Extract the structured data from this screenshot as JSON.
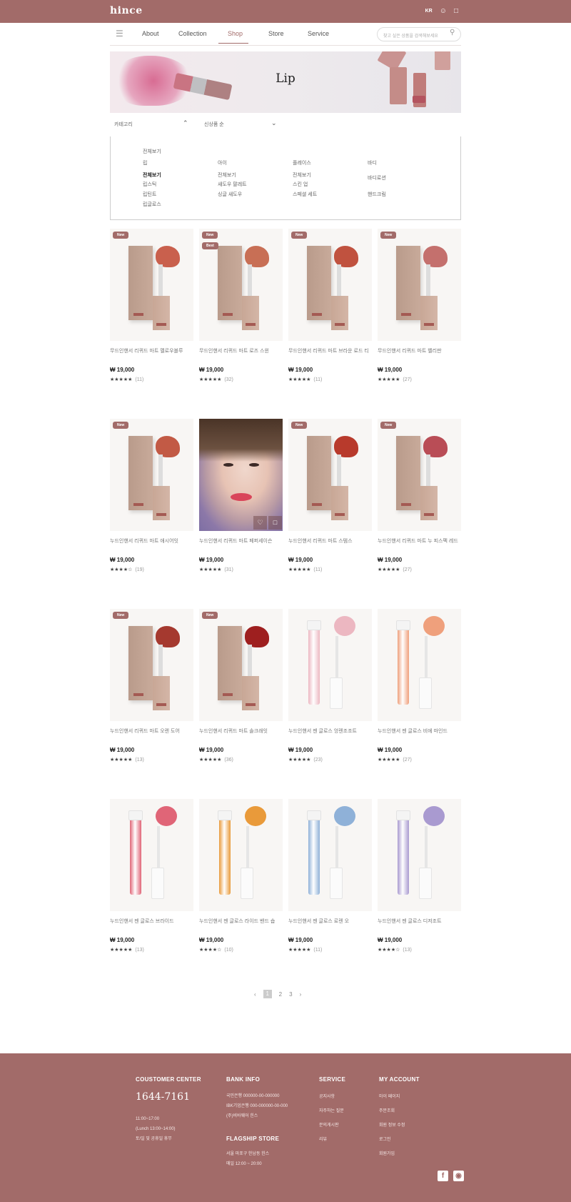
{
  "header": {
    "brand": "hince",
    "lang": "KR",
    "icons": [
      "user-icon",
      "bag-icon"
    ]
  },
  "nav": {
    "items": [
      "About",
      "Collection",
      "Shop",
      "Store",
      "Service"
    ],
    "active": "Shop",
    "search_placeholder": "찾고 싶은 상품을 검색해보세요"
  },
  "banner": {
    "title": "Lip"
  },
  "filters": {
    "category": "카테고리",
    "sort": "신상품 순"
  },
  "categories": {
    "all": "전체보기",
    "col1": [
      "립",
      "전체보기",
      "립스틱",
      "립틴트",
      "립글로스"
    ],
    "col2": [
      "아이",
      "전체보기",
      "섀도우 팔레트",
      "싱글 섀도우"
    ],
    "col3": [
      "플레이스",
      "전체보기",
      "스킨 업",
      "스페셜 세트"
    ],
    "col4": [
      "바디",
      "바디로션",
      "핸드크림"
    ]
  },
  "products": [
    {
      "name": "무드인핸서 리퀴드 마트 멜로우블루",
      "price": "₩ 19,000",
      "stars": "★★★★★",
      "count": "(11)",
      "badges": [
        "New"
      ]
    },
    {
      "name": "무드인핸서 리퀴드 마트 로즈 스윈",
      "price": "₩ 19,000",
      "stars": "★★★★★",
      "count": "(32)",
      "badges": [
        "New",
        "Best"
      ]
    },
    {
      "name": "무드인핸서 리퀴드 마트 브라운 로드 티",
      "price": "₩ 19,000",
      "stars": "★★★★★",
      "count": "(11)",
      "badges": [
        "New"
      ]
    },
    {
      "name": "무드인핸서 리퀴드 마트 벨리판",
      "price": "₩ 19,000",
      "stars": "★★★★★",
      "count": "(27)",
      "badges": [
        "New"
      ]
    },
    {
      "name": "누드인핸서 리퀴드 마트 애시어잇",
      "price": "₩ 19,000",
      "stars": "★★★★☆",
      "count": "(19)",
      "badges": [
        "New"
      ]
    },
    {
      "name": "누드인핸서 리퀴드 마트 페퍼세이슨",
      "price": "₩ 19,000",
      "stars": "★★★★★",
      "count": "(31)",
      "badges": []
    },
    {
      "name": "누드인핸서 리퀴드 마트 스템스",
      "price": "₩ 19,000",
      "stars": "★★★★★",
      "count": "(11)",
      "badges": [
        "New"
      ]
    },
    {
      "name": "누드인핸서 리퀴드 마트 누 피스펙 레드",
      "price": "₩ 19,000",
      "stars": "★★★★★",
      "count": "(27)",
      "badges": [
        "New"
      ]
    },
    {
      "name": "누드인핸서 리퀴드 마트 오렌 도어",
      "price": "₩ 19,000",
      "stars": "★★★★★",
      "count": "(13)",
      "badges": [
        "New"
      ]
    },
    {
      "name": "누드인핸서 리퀴드 마트 솔크래잇",
      "price": "₩ 19,000",
      "stars": "★★★★★",
      "count": "(36)",
      "badges": [
        "New"
      ]
    },
    {
      "name": "누드인핸서 젠 글로스 엉렌조조트",
      "price": "₩ 19,000",
      "stars": "★★★★★",
      "count": "(23)",
      "badges": []
    },
    {
      "name": "누드인핸서 젠 글로스 비에 마인드",
      "price": "₩ 19,000",
      "stars": "★★★★★",
      "count": "(27)",
      "badges": []
    },
    {
      "name": "누드인핸서 젠 글로스 브라이드",
      "price": "₩ 19,000",
      "stars": "★★★★★",
      "count": "(13)",
      "badges": []
    },
    {
      "name": "누드인핸서 젠 글로스 라이드 밴드 숍",
      "price": "₩ 19,000",
      "stars": "★★★★☆",
      "count": "(10)",
      "badges": []
    },
    {
      "name": "누드인핸서 젠 글로스 로렌 오",
      "price": "₩ 19,000",
      "stars": "★★★★★",
      "count": "(11)",
      "badges": []
    },
    {
      "name": "누드인핸서 젠 글로스 디저조트",
      "price": "₩ 19,000",
      "stars": "★★★★☆",
      "count": "(13)",
      "badges": []
    }
  ],
  "product_visuals": [
    {
      "kind": "stick",
      "color": "#c9604d"
    },
    {
      "kind": "stick",
      "color": "#c86f55"
    },
    {
      "kind": "stick",
      "color": "#c0523f"
    },
    {
      "kind": "stick",
      "color": "#c4706d"
    },
    {
      "kind": "stick",
      "color": "#c25a45"
    },
    {
      "kind": "portrait",
      "color": "#d9455a"
    },
    {
      "kind": "stick",
      "color": "#b83a2c"
    },
    {
      "kind": "stick",
      "color": "#b94d56"
    },
    {
      "kind": "stick",
      "color": "#a5392f"
    },
    {
      "kind": "stick",
      "color": "#9e1f1f"
    },
    {
      "kind": "gloss",
      "color": "#ecb7c1"
    },
    {
      "kind": "gloss",
      "color": "#efa07c"
    },
    {
      "kind": "gloss",
      "color": "#e06577"
    },
    {
      "kind": "gloss",
      "color": "#e99a3a"
    },
    {
      "kind": "gloss",
      "color": "#8fb1d8"
    },
    {
      "kind": "gloss",
      "color": "#a99ad0"
    }
  ],
  "pagination": {
    "prev": "‹",
    "pages": [
      "1",
      "2",
      "3"
    ],
    "current": "1",
    "next": "›"
  },
  "footer": {
    "cs_title": "COUSTOMER CENTER",
    "phone": "1644-7161",
    "hours": [
      "11:00~17:00",
      "(Lunch 13:00~14:00)",
      "토/일 및 공휴일 휴무"
    ],
    "bank_title": "BANK INFO",
    "bank_lines": [
      "국민은행 000000-00-000000",
      "IBK기업은행 000-000000-00-000",
      "(주)비바웨어 힌스"
    ],
    "store_title": "FLAGSHIP STORE",
    "store_lines": [
      "서울 마포구 한남동 힌스",
      "매일 12:00 ~ 20:00"
    ],
    "service_title": "SERVICE",
    "service_items": [
      "공지사항",
      "자주하는 질문",
      "문의게시판",
      "리뷰"
    ],
    "account_title": "MY ACCOUNT",
    "account_items": [
      "마이 페이지",
      "주문조회",
      "회원 정보 수정",
      "로그인",
      "회원가입"
    ],
    "accent": "#a26b69"
  }
}
